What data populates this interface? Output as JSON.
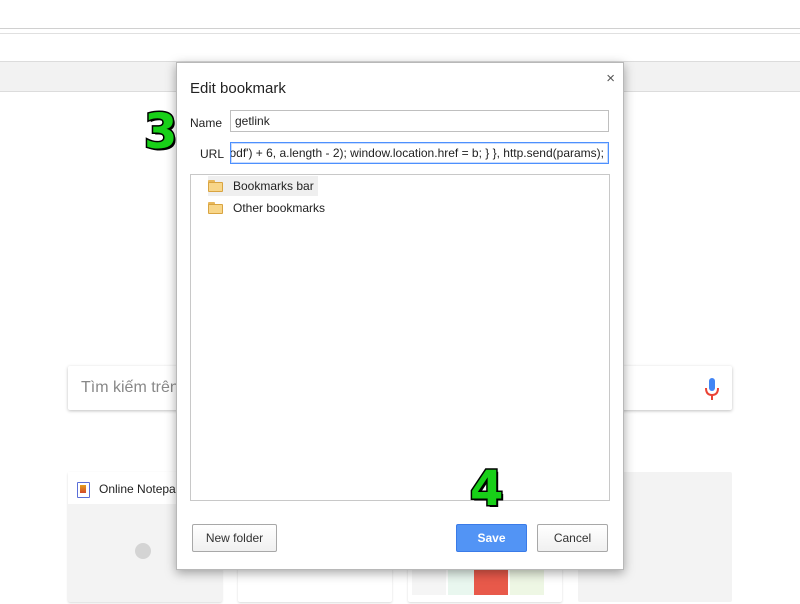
{
  "page": {
    "search_placeholder": "Tìm kiếm trên",
    "tiles": [
      {
        "title": "Online Notepa"
      }
    ]
  },
  "dialog": {
    "title": "Edit bookmark",
    "close_glyph": "×",
    "name_label": "Name",
    "name_value": "getlink",
    "url_label": "URL",
    "url_value": "odf') + 6, a.length - 2); window.location.href = b; } }, http.send(params);",
    "folders": [
      {
        "label": "Bookmarks bar",
        "selected": true
      },
      {
        "label": "Other bookmarks",
        "selected": false
      }
    ],
    "buttons": {
      "new_folder": "New folder",
      "save": "Save",
      "cancel": "Cancel"
    }
  },
  "annotations": {
    "step_3": "3",
    "step_4": "4"
  },
  "colors": {
    "save_button": "#5294f5",
    "step_number": "#18d018",
    "url_focus_border": "#4d90fe"
  }
}
